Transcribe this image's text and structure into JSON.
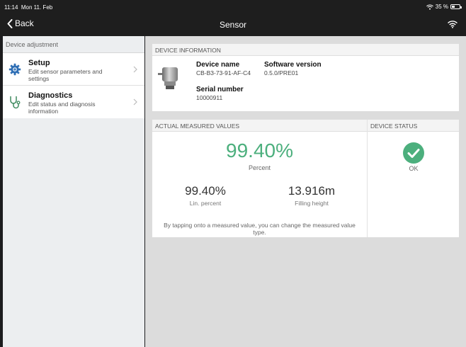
{
  "status_bar": {
    "time": "11:14",
    "date": "Mon 11. Feb",
    "battery": "35 %",
    "battery_level": 0.35
  },
  "nav": {
    "back_label": "Back",
    "title": "Sensor"
  },
  "sidebar": {
    "header": "Device adjustment",
    "items": [
      {
        "title": "Setup",
        "subtitle": "Edit sensor parameters and settings",
        "icon": "gear-icon"
      },
      {
        "title": "Diagnostics",
        "subtitle": "Edit status and diagnosis information",
        "icon": "stethoscope-icon"
      }
    ]
  },
  "device_info": {
    "header": "DEVICE INFORMATION",
    "device_name_label": "Device name",
    "device_name": "CB-B3-73-91-AF-C4",
    "software_version_label": "Software version",
    "software_version": "0.5.0/PRE01",
    "serial_number_label": "Serial number",
    "serial_number": "10000911"
  },
  "measured": {
    "header": "ACTUAL MEASURED VALUES",
    "primary_value": "99.40%",
    "primary_unit": "Percent",
    "lin_value": "99.40%",
    "lin_label": "Lin. percent",
    "height_value": "13.916m",
    "height_label": "Filling height",
    "hint": "By tapping onto a measured value, you can change the measured value type."
  },
  "device_status": {
    "header": "DEVICE STATUS",
    "status": "OK"
  },
  "colors": {
    "accent_green": "#4caf7d",
    "nav_bg": "#1e1e1e",
    "icon_blue": "#2f6fb5",
    "icon_green": "#3e8a5e"
  }
}
